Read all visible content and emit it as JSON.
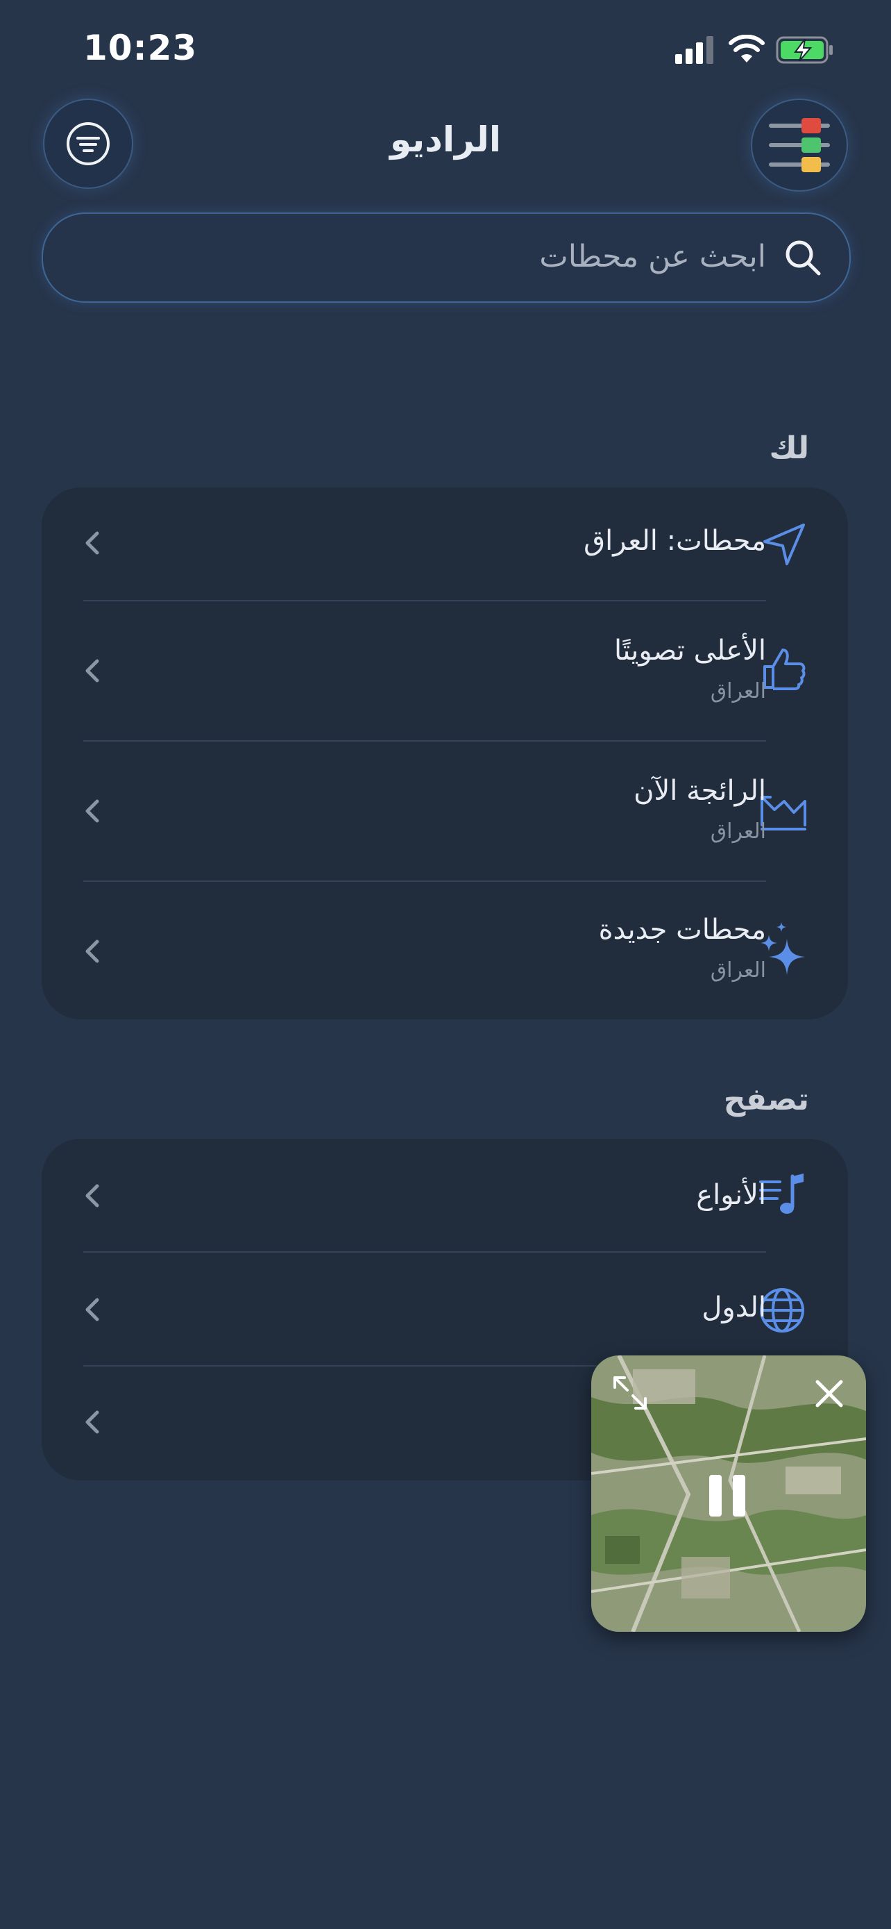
{
  "status_bar": {
    "time": "10:23"
  },
  "header": {
    "title": "الراديو"
  },
  "search": {
    "placeholder": "ابحث عن محطات"
  },
  "for_you": {
    "heading": "لك",
    "items": [
      {
        "title": "محطات: العراق",
        "subtitle": "",
        "icon": "location-arrow-icon"
      },
      {
        "title": "الأعلى تصويتًا",
        "subtitle": "العراق",
        "icon": "thumbs-up-icon"
      },
      {
        "title": "الرائجة الآن",
        "subtitle": "العراق",
        "icon": "trending-chart-icon"
      },
      {
        "title": "محطات جديدة",
        "subtitle": "العراق",
        "icon": "sparkles-icon"
      }
    ]
  },
  "browse": {
    "heading": "تصفح",
    "items": [
      {
        "title": "الأنواع",
        "icon": "music-list-icon"
      },
      {
        "title": "الدول",
        "icon": "globe-icon"
      },
      {
        "title": "",
        "icon": ""
      }
    ]
  },
  "colors": {
    "accent": "#5b8ee6",
    "background": "#27354b",
    "card": "#212d3d"
  }
}
